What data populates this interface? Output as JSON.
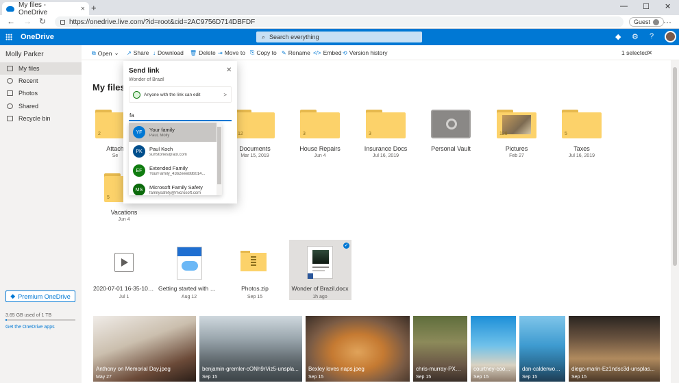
{
  "browser": {
    "tab_title": "My files - OneDrive",
    "tab_close": "×",
    "new_tab": "+",
    "url": "https://onedrive.live.com/?id=root&cid=2AC9756D714DBFDF",
    "profile": "Guest",
    "more": "···",
    "minimize": "—",
    "maximize": "☐",
    "close": "✕",
    "back": "←",
    "forward": "→",
    "refresh": "↻"
  },
  "suite": {
    "brand": "OneDrive",
    "search_placeholder": "Search everything",
    "diamond": "◆",
    "settings": "⚙",
    "help": "?"
  },
  "nav": {
    "user": "Molly Parker",
    "items": [
      {
        "label": "My files",
        "active": true
      },
      {
        "label": "Recent"
      },
      {
        "label": "Photos"
      },
      {
        "label": "Shared"
      },
      {
        "label": "Recycle bin"
      }
    ],
    "premium": "Premium OneDrive",
    "storage": "3.65 GB used of 1 TB",
    "storage_fraction": 0.004,
    "get_apps": "Get the OneDrive apps"
  },
  "commands": {
    "open": "Open",
    "share": "Share",
    "download": "Download",
    "delete": "Delete",
    "move": "Move to",
    "copy": "Copy to",
    "rename": "Rename",
    "embed": "Embed",
    "version": "Version history",
    "selected": "1 selected",
    "clear": "✕"
  },
  "page_title": "My files",
  "folders": {
    "attach": {
      "name": "Attach",
      "date": "Se",
      "count": "2"
    },
    "documents": {
      "name": "Documents",
      "date": "Mar 15, 2019",
      "count": "12"
    },
    "house": {
      "name": "House Repairs",
      "date": "Jun 4",
      "count": "3"
    },
    "insurance": {
      "name": "Insurance Docs",
      "date": "Jul 16, 2019",
      "count": "3"
    },
    "vault": {
      "name": "Personal Vault",
      "date": ""
    },
    "pictures": {
      "name": "Pictures",
      "date": "Feb 27",
      "count": "128"
    },
    "taxes": {
      "name": "Taxes",
      "date": "Jul 16, 2019",
      "count": "5"
    },
    "vacations": {
      "name": "Vacations",
      "date": "Jun 4",
      "count": "5"
    }
  },
  "files": {
    "video": {
      "name": "2020-07-01 16-35-10.m...",
      "date": "Jul 1"
    },
    "getting": {
      "name": "Getting started with On...",
      "date": "Aug 12"
    },
    "zip": {
      "name": "Photos.zip",
      "date": "Sep 15"
    },
    "docx": {
      "name": "Wonder of Brazil.docx",
      "date": "1h ago"
    }
  },
  "photos": [
    {
      "name": "Anthony on Memorial Day.jpeg",
      "date": "May 27"
    },
    {
      "name": "benjamin-gremler-cONh9rViz5-unspla...",
      "date": "Sep 15"
    },
    {
      "name": "Bexley loves naps.jpeg",
      "date": "Sep 15"
    },
    {
      "name": "chris-murray-PXVQ...",
      "date": "Sep 15"
    },
    {
      "name": "courtney-cook-...",
      "date": "Sep 15"
    },
    {
      "name": "dan-calderwoo...",
      "date": "Sep 15"
    },
    {
      "name": "diego-marin-Ez1ndsc3d-unsplas...",
      "date": "Sep 15"
    }
  ],
  "send_link": {
    "title": "Send link",
    "close": "✕",
    "file": "Wonder of Brazil",
    "permission": "Anyone with the link can edit",
    "chevron": ">",
    "input": "fa",
    "suggestions": [
      {
        "initials": "YF",
        "name": "Your family",
        "email": "Paul, Molly",
        "color": "#0078d4"
      },
      {
        "initials": "PK",
        "name": "Paul Koch",
        "email": "surfstories@aol.com",
        "color": "#004e8c"
      },
      {
        "initials": "EF",
        "name": "Extended Family",
        "email": "YourFamily_4362eee88b014...",
        "color": "#107c10"
      },
      {
        "initials": "MS",
        "name": "Microsoft Family Safety",
        "email": "familysafety@microsoft.com",
        "color": "#0b6a0b"
      }
    ]
  },
  "colors": {
    "accent": "#0078d4",
    "folder": "#fcd26a"
  }
}
